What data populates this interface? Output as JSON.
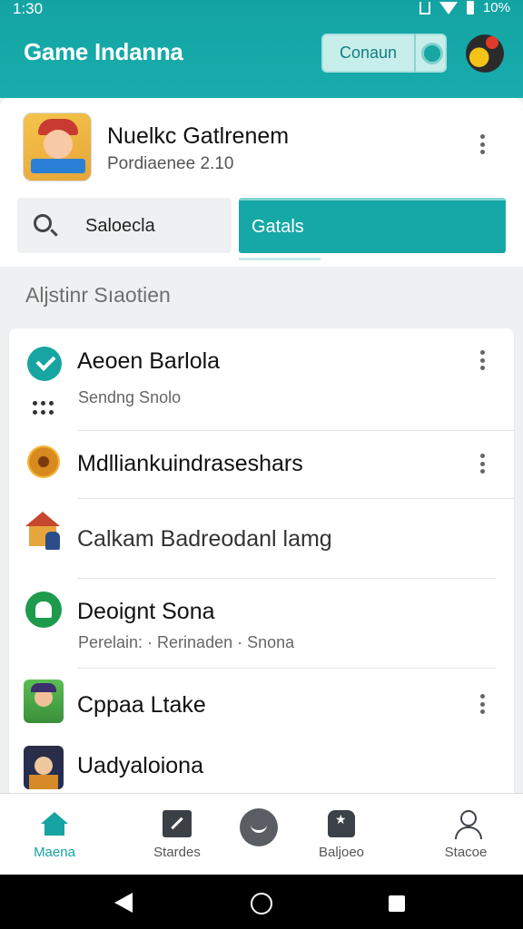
{
  "status_bar": {
    "time": "1:30",
    "battery_text": "10%"
  },
  "header": {
    "title": "Game Indanna",
    "connect_label": "Conaun"
  },
  "featured": {
    "name": "Nuelkc Gatlrenem",
    "subtitle": "Pordiaenee 2.10"
  },
  "search": {
    "label": "Saloecla"
  },
  "tab": {
    "label": "Gatals"
  },
  "section": {
    "title": "Aljstinr Sıaotien"
  },
  "list": [
    {
      "title": "Aeoen Barlola",
      "subtitle": "Sendng Snolo",
      "icon": "check-circle-icon"
    },
    {
      "title": "Mdlliankuindraseshars",
      "icon": "coin-icon"
    },
    {
      "title": "Calkam Badreodanl lamg",
      "icon": "house-game-icon"
    },
    {
      "title": "Deoignt Sona",
      "subtitle": "Perelain: · Rerinaden · Snona",
      "icon": "green-badge-icon"
    },
    {
      "title": "Cppaa Ltake",
      "icon": "character-icon"
    },
    {
      "title": "Uadyaloiona",
      "icon": "character-icon"
    }
  ],
  "bottom_nav": [
    {
      "label": "Maena",
      "icon": "home-icon",
      "active": true
    },
    {
      "label": "Stardes",
      "icon": "tools-icon"
    },
    {
      "label": "",
      "icon": "smile-icon"
    },
    {
      "label": "Baljoeo",
      "icon": "badge-icon"
    },
    {
      "label": "Stacoe",
      "icon": "person-icon"
    }
  ],
  "colors": {
    "accent": "#17a6a3",
    "background": "#eef0f1"
  }
}
